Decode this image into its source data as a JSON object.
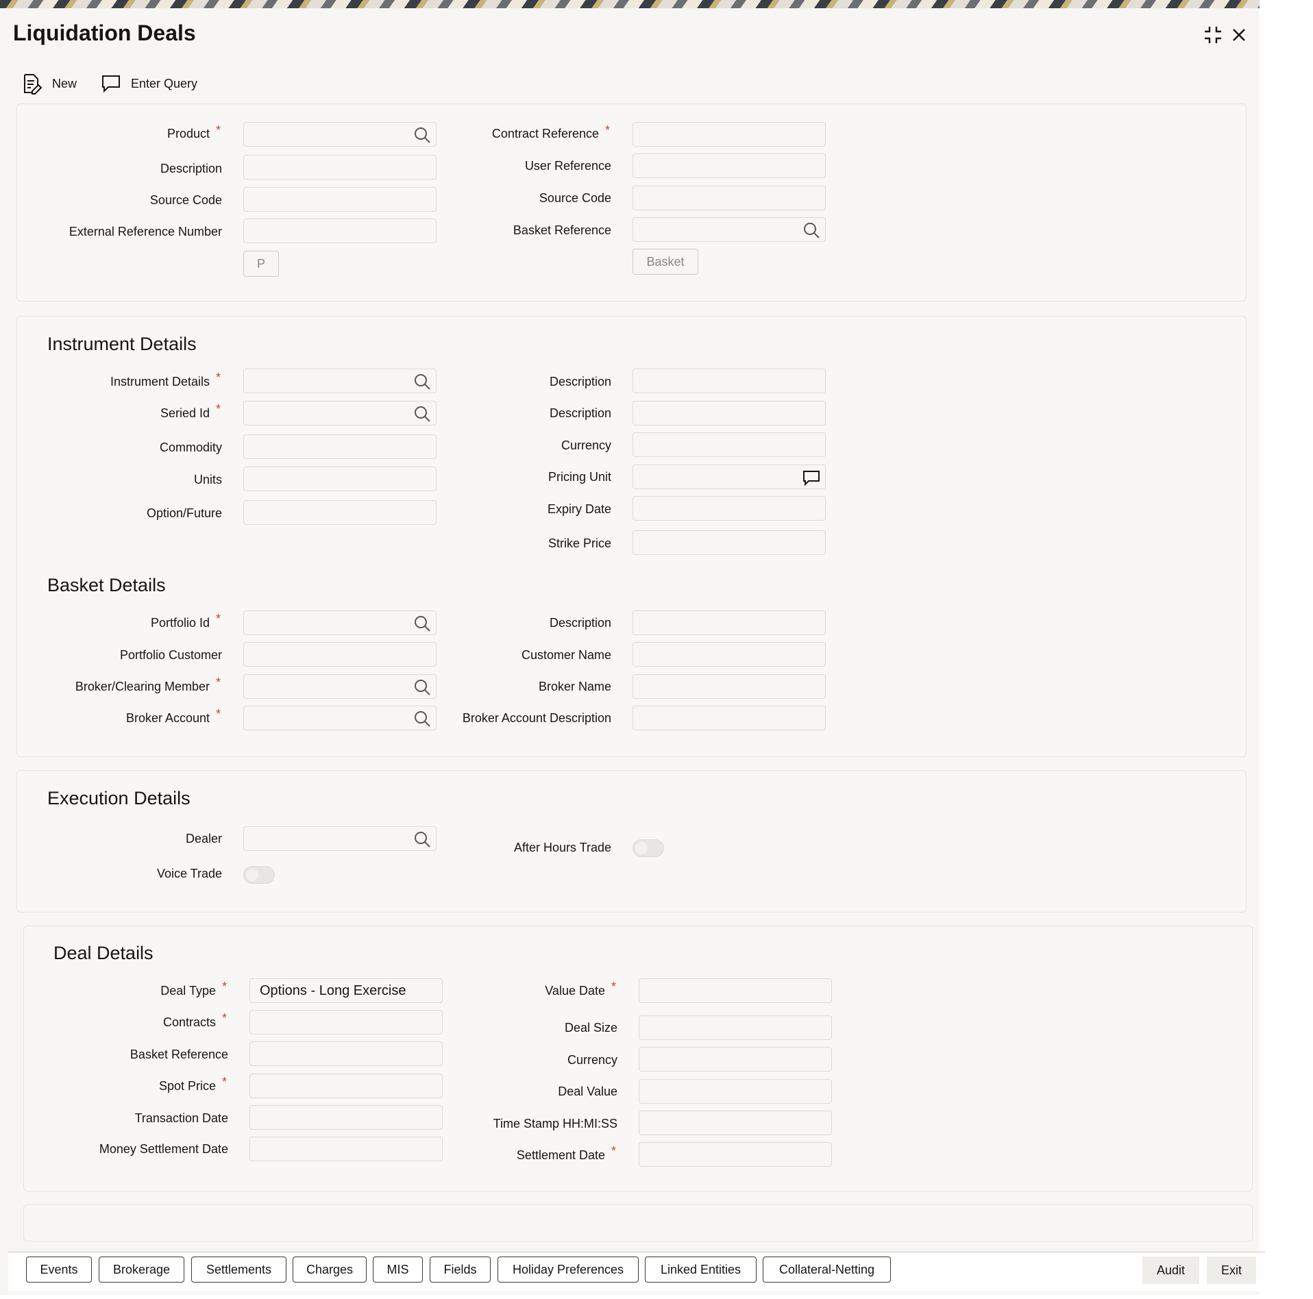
{
  "window": {
    "title": "Liquidation Deals"
  },
  "toolbar": {
    "new_label": "New",
    "enter_query_label": "Enter Query"
  },
  "header_section": {
    "product_label": "Product",
    "description_label": "Description",
    "source_code_label": "Source Code",
    "external_ref_label": "External Reference Number",
    "p_button": "P",
    "contract_ref_label": "Contract Reference",
    "user_ref_label": "User Reference",
    "source_code2_label": "Source Code",
    "basket_ref_label": "Basket Reference",
    "basket_button": "Basket"
  },
  "instrument": {
    "title": "Instrument Details",
    "instrument_details_label": "Instrument Details",
    "seried_id_label": "Seried Id",
    "commodity_label": "Commodity",
    "units_label": "Units",
    "option_future_label": "Option/Future",
    "description1_label": "Description",
    "description2_label": "Description",
    "currency_label": "Currency",
    "pricing_unit_label": "Pricing Unit",
    "expiry_date_label": "Expiry Date",
    "strike_price_label": "Strike Price"
  },
  "basket": {
    "title": "Basket Details",
    "portfolio_id_label": "Portfolio Id",
    "portfolio_customer_label": "Portfolio Customer",
    "broker_clearing_label": "Broker/Clearing Member",
    "broker_account_label": "Broker Account",
    "description_label": "Description",
    "customer_name_label": "Customer Name",
    "broker_name_label": "Broker Name",
    "broker_account_desc_label": "Broker Account Description"
  },
  "execution": {
    "title": "Execution Details",
    "dealer_label": "Dealer",
    "voice_trade_label": "Voice Trade",
    "after_hours_label": "After Hours Trade"
  },
  "deal": {
    "title": "Deal Details",
    "deal_type_label": "Deal Type",
    "deal_type_value": "Options - Long Exercise",
    "contracts_label": "Contracts",
    "basket_reference_label": "Basket Reference",
    "spot_price_label": "Spot Price",
    "transaction_date_label": "Transaction Date",
    "money_settlement_label": "Money Settlement Date",
    "value_date_label": "Value Date",
    "deal_size_label": "Deal Size",
    "currency_label": "Currency",
    "deal_value_label": "Deal Value",
    "timestamp_label": "Time Stamp HH:MI:SS",
    "settlement_date_label": "Settlement Date"
  },
  "footer": {
    "events": "Events",
    "brokerage": "Brokerage",
    "settlements": "Settlements",
    "charges": "Charges",
    "mis": "MIS",
    "fields": "Fields",
    "holiday_preferences": "Holiday Preferences",
    "linked_entities": "Linked Entities",
    "collateral_netting": "Collateral-Netting",
    "audit": "Audit",
    "exit": "Exit"
  },
  "colors": {
    "required_asterisk": "#c74634",
    "background": "#f7f6f4"
  }
}
